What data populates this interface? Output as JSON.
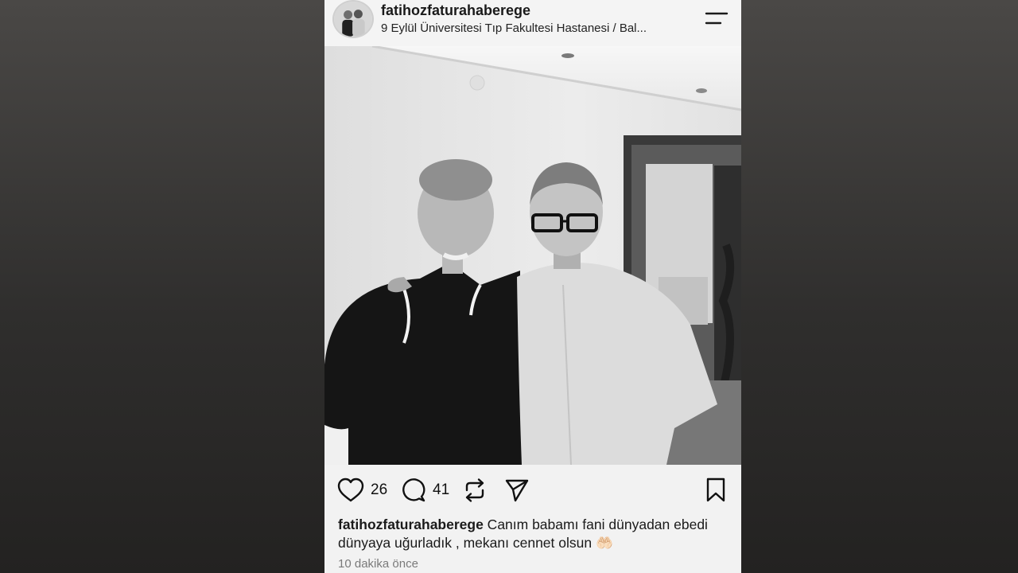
{
  "post": {
    "username": "fatihozfaturahaberege",
    "location": "9 Eylül Üniversitesi Tıp Fakultesi Hastanesi / Bal...",
    "likes": "26",
    "comments": "41",
    "caption_user": "fatihozfaturahaberege",
    "caption_text": " Canım babamı fani dünyadan ebedi dünyaya uğurladık , mekanı cennet olsun 🤲🏻",
    "timestamp": "10 dakika önce"
  },
  "icons": {
    "menu": "menu-icon",
    "like": "heart-icon",
    "comment": "comment-icon",
    "repost": "repost-icon",
    "share": "send-icon",
    "save": "bookmark-icon"
  },
  "colors": {
    "background": "#2f2e2d",
    "card": "#f2f2f2",
    "text": "#1a1a1a",
    "muted": "#7a7a7a"
  }
}
